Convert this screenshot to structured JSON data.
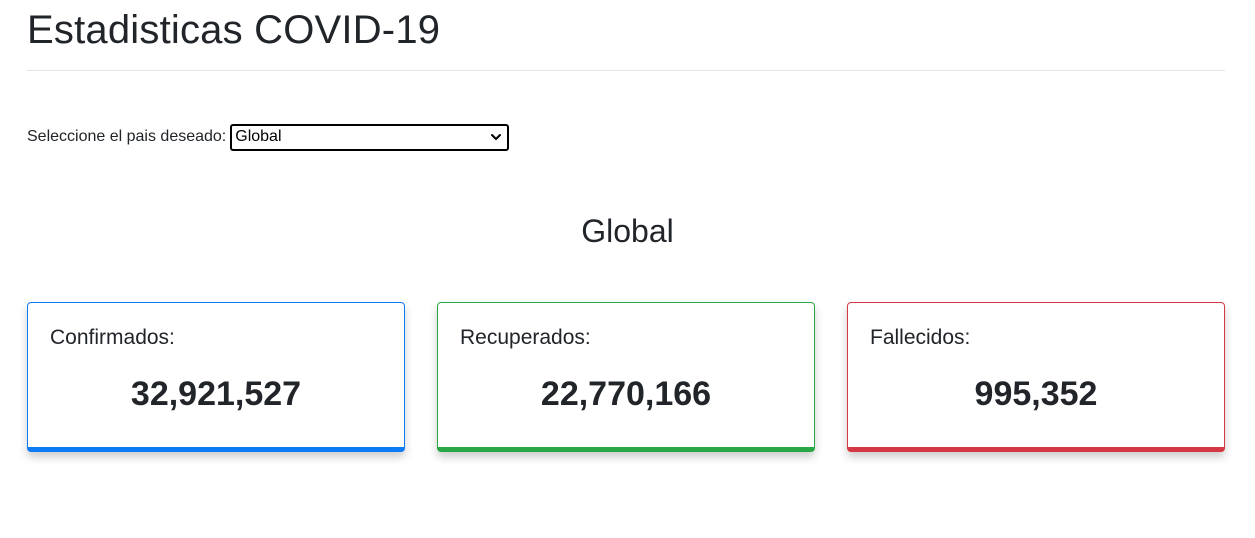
{
  "header": {
    "title": "Estadisticas COVID-19"
  },
  "selector": {
    "label": "Seleccione el pais deseado:",
    "selected": "Global"
  },
  "region": {
    "title": "Global"
  },
  "cards": [
    {
      "label": "Confirmados:",
      "value": "32,921,527",
      "color": "#0d7bf6"
    },
    {
      "label": "Recuperados:",
      "value": "22,770,166",
      "color": "#29a745"
    },
    {
      "label": "Fallecidos:",
      "value": "995,352",
      "color": "#d63745"
    }
  ]
}
